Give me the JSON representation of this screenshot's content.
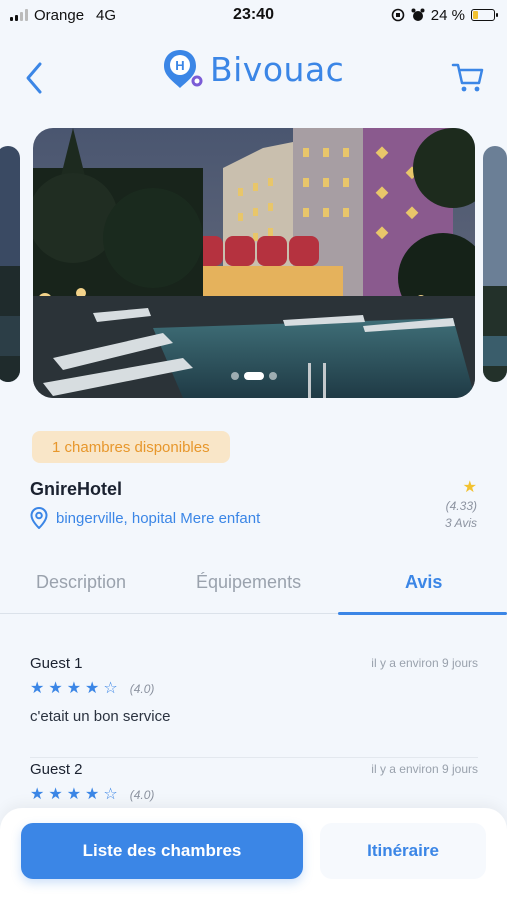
{
  "status_bar": {
    "carrier": "Orange",
    "network": "4G",
    "time": "23:40",
    "battery_text": "24 %",
    "battery_level": 0.24
  },
  "header": {
    "app_name": "Bivouac",
    "logo_letter": "H"
  },
  "carousel": {
    "slide_count": 3,
    "active_index": 1
  },
  "hotel": {
    "availability": "1 chambres disponibles",
    "name": "GnireHotel",
    "location": "bingerville, hopital Mere enfant",
    "rating": "(4.33)",
    "reviews_count": "3 Avis"
  },
  "tabs": [
    {
      "label": "Description"
    },
    {
      "label": "Équipements"
    },
    {
      "label": "Avis"
    }
  ],
  "active_tab": "Avis",
  "reviews": [
    {
      "name": "Guest 1",
      "time": "il y a environ 9 jours",
      "score": "(4.0)",
      "stars": 4,
      "text": "c'etait un bon service"
    },
    {
      "name": "Guest 2",
      "time": "il y a environ 9 jours",
      "score": "(4.0)",
      "stars": 4,
      "text": ""
    }
  ],
  "actions": {
    "primary": "Liste des chambres",
    "secondary": "Itinéraire"
  },
  "colors": {
    "accent": "#3b86e6",
    "availability_bg": "#f9e6c8",
    "availability_text": "#e7972c",
    "rating_star": "#f2c230"
  }
}
